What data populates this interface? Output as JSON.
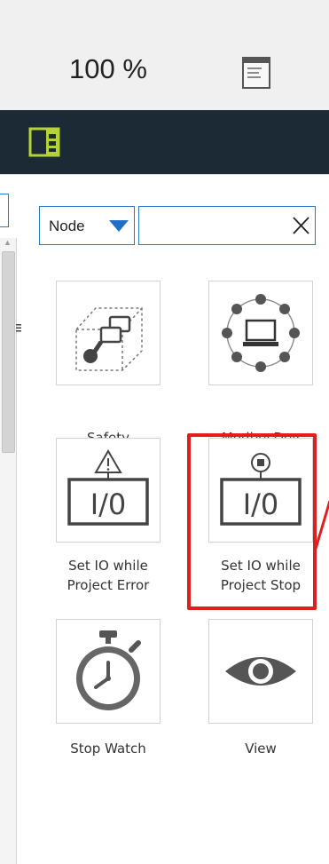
{
  "toolbar": {
    "zoom_level": "100 %",
    "doc_icon": "document-icon",
    "panel_icon": "panel-toggle-icon"
  },
  "filter": {
    "select_value": "Node",
    "search_value": "",
    "clear_icon": "close-icon"
  },
  "tiles": [
    {
      "label": "Safety",
      "icon": "safety-icon"
    },
    {
      "label": "ModbusDev",
      "icon": "network-device-icon"
    },
    {
      "label_line1": "Set IO while",
      "label_line2": "Project Error",
      "icon": "io-warning-icon"
    },
    {
      "label_line1": "Set IO while",
      "label_line2": "Project Stop",
      "icon": "io-stop-icon"
    },
    {
      "label": "Stop Watch",
      "icon": "stopwatch-icon"
    },
    {
      "label": "View",
      "icon": "eye-icon"
    }
  ],
  "colors": {
    "dark_bar": "#1c2a35",
    "accent_green": "#b5d334",
    "focus_blue": "#2a78c8",
    "highlight_red": "#e01e1e"
  }
}
